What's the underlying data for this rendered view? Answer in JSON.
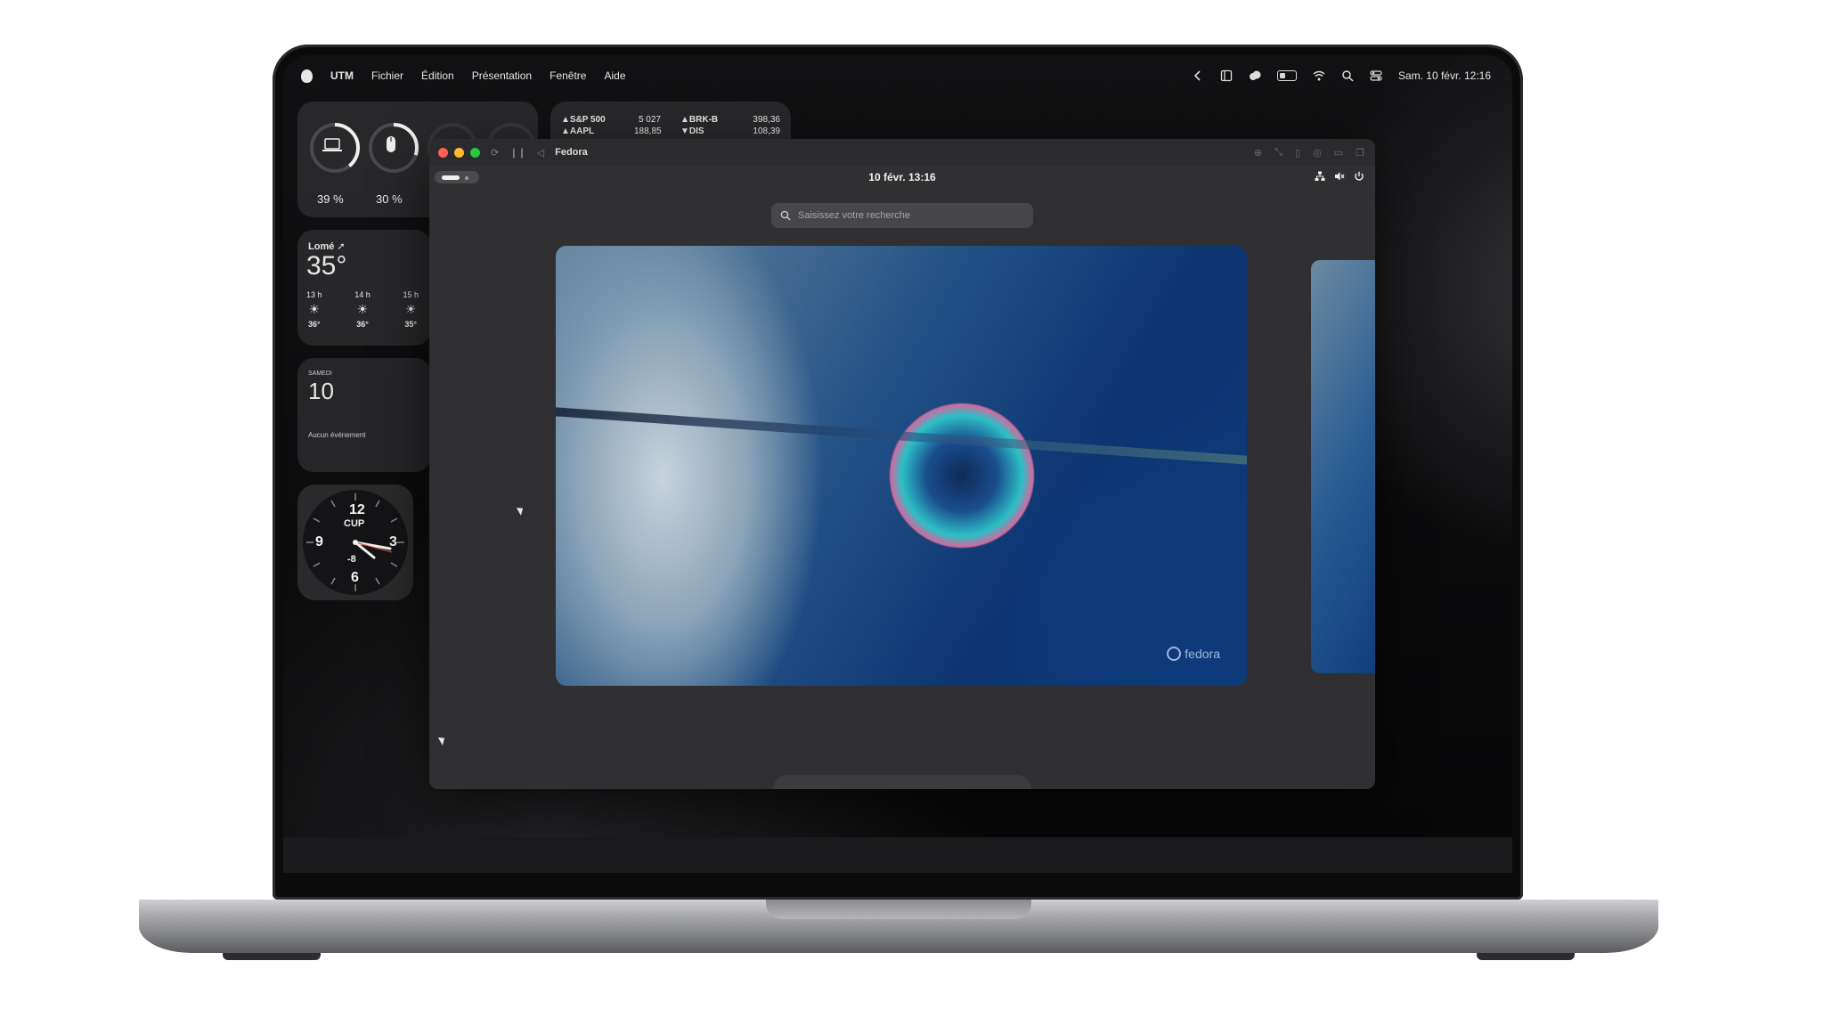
{
  "menubar": {
    "app": "UTM",
    "menus": [
      "Fichier",
      "Édition",
      "Présentation",
      "Fenêtre",
      "Aide"
    ],
    "clock": "Sam. 10 févr. 12:16",
    "icons": [
      "chevron-left-icon",
      "sidebar-icon",
      "creative-cloud-icon",
      "battery-icon",
      "wifi-icon",
      "search-icon",
      "control-center-icon"
    ]
  },
  "widgets": {
    "battery": {
      "laptop_percent": "39 %",
      "mouse_percent": "30 %",
      "laptop_level": 0.39,
      "mouse_level": 0.3
    },
    "stocks": [
      {
        "symbol": "▲S&P 500",
        "value": "5 027"
      },
      {
        "symbol": "▲AAPL",
        "value": "188,85"
      },
      {
        "symbol": "▲BRK-B",
        "value": "398,36"
      },
      {
        "symbol": "▼DIS",
        "value": "108,39"
      }
    ],
    "weather": {
      "location": "Lomé ➚",
      "temp": "35°",
      "hours": [
        {
          "time": "13 h",
          "temp": "36°"
        },
        {
          "time": "14 h",
          "temp": "36°"
        },
        {
          "time": "15 h",
          "temp": "35°"
        }
      ]
    },
    "calendar": {
      "weekday": "SAMEDI",
      "day": "10",
      "events": "Aucun événement"
    },
    "clock": {
      "city": "CUP",
      "n12": "12",
      "n3": "3",
      "n6": "6",
      "n9": "9",
      "offset": "-8"
    }
  },
  "vm": {
    "title": "Fedora",
    "gnome_clock": "10 févr. 13:16",
    "search_placeholder": "Saisissez votre recherche",
    "logo_text": "fedora",
    "dash": [
      "firefox-icon",
      "calendar-icon",
      "text-editor-icon",
      "software-icon",
      "app-grid-icon"
    ]
  }
}
